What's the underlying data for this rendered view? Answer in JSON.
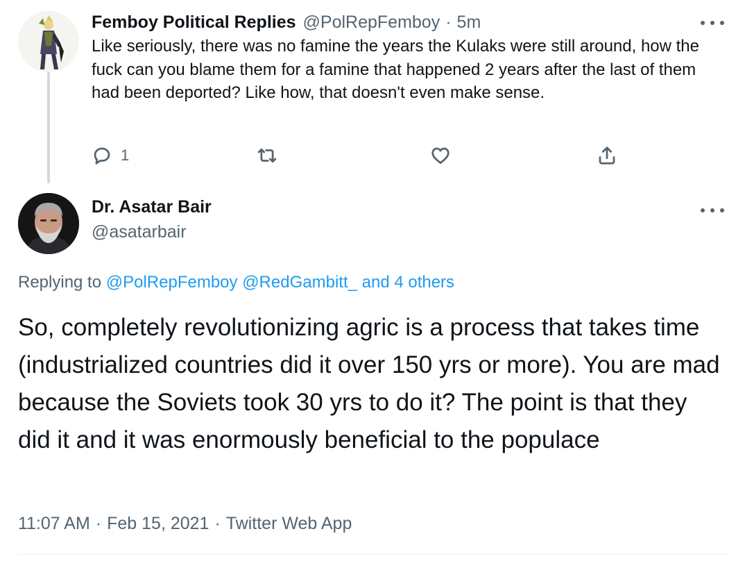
{
  "parent_tweet": {
    "display_name": "Femboy Political Replies",
    "handle": "@PolRepFemboy",
    "separator": "·",
    "time_ago": "5m",
    "text": "Like seriously, there was no famine the years the Kulaks were still around, how the fuck can you blame them for a famine that happened 2 years after the last of them had been deported? Like how, that doesn't even make sense.",
    "reply_count": "1",
    "icons": {
      "reply": "reply-icon",
      "retweet": "retweet-icon",
      "like": "heart-icon",
      "share": "share-icon",
      "more": "more-icon"
    }
  },
  "main_tweet": {
    "display_name": "Dr. Asatar Bair",
    "handle": "@asatarbair",
    "replying_prefix": "Replying to",
    "replying_to": "@PolRepFemboy @RedGambitt_ and 4 others",
    "text": "So, completely revolutionizing agric is a process that takes time (industrialized countries did it over 150 yrs or more). You are mad because the Soviets took 30 yrs to do it? The point is that they did it and it was enormously beneficial to the populace",
    "time": "11:07 AM",
    "separator": "·",
    "date": "Feb 15, 2021",
    "source": "Twitter Web App"
  },
  "colors": {
    "text": "#0f1419",
    "muted": "#536471",
    "link": "#1d9bf0",
    "thread_line": "#cfd9de"
  }
}
